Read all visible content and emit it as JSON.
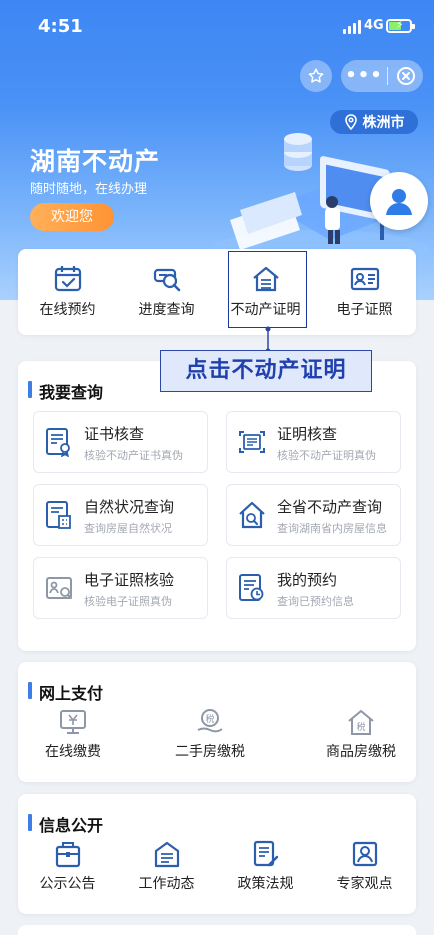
{
  "status_bar": {
    "time": "4:51",
    "network": "4G"
  },
  "banner": {
    "title": "湖南不动产",
    "subtitle": "随时随地，在线办理",
    "welcome_label": "欢迎您",
    "city": "株洲市"
  },
  "quick_actions": [
    {
      "label": "在线预约",
      "icon": "calendar-check-icon"
    },
    {
      "label": "进度查询",
      "icon": "search-progress-icon"
    },
    {
      "label": "不动产证明",
      "icon": "house-certificate-icon"
    },
    {
      "label": "电子证照",
      "icon": "id-card-icon"
    }
  ],
  "callout": {
    "text": "点击不动产证明"
  },
  "query_section": {
    "title": "我要查询",
    "items": [
      {
        "title": "证书核查",
        "subtitle": "核验不动产证书真伪",
        "icon": "certificate-check-icon"
      },
      {
        "title": "证明核查",
        "subtitle": "核验不动产证明真伪",
        "icon": "proof-check-icon"
      },
      {
        "title": "自然状况查询",
        "subtitle": "查询房屋自然状况",
        "icon": "building-doc-icon"
      },
      {
        "title": "全省不动产查询",
        "subtitle": "查询湖南省内房屋信息",
        "icon": "house-search-icon"
      },
      {
        "title": "电子证照核验",
        "subtitle": "核验电子证照真伪",
        "icon": "e-license-check-icon"
      },
      {
        "title": "我的预约",
        "subtitle": "查询已预约信息",
        "icon": "appointment-clock-icon"
      }
    ]
  },
  "payment_section": {
    "title": "网上支付",
    "items": [
      {
        "label": "在线缴费",
        "icon": "online-payment-icon"
      },
      {
        "label": "二手房缴税",
        "icon": "tax-hand-icon"
      },
      {
        "label": "商品房缴税",
        "icon": "tax-house-icon"
      }
    ]
  },
  "info_section": {
    "title": "信息公开",
    "items": [
      {
        "label": "公示公告",
        "icon": "announcement-bag-icon"
      },
      {
        "label": "工作动态",
        "icon": "work-news-icon"
      },
      {
        "label": "政策法规",
        "icon": "policy-doc-icon"
      },
      {
        "label": "专家观点",
        "icon": "expert-icon"
      }
    ]
  },
  "colors": {
    "primary": "#3e86f3",
    "accent": "#3f7de8",
    "orange": "#ff9333",
    "icon": "#2b5fae",
    "callout_text": "#2040ae"
  }
}
